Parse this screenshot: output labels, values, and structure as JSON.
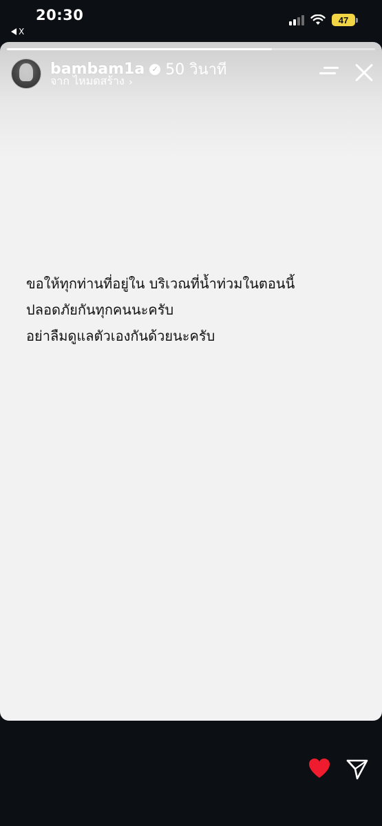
{
  "status_bar": {
    "time": "20:30",
    "back_label": "X",
    "battery": "47"
  },
  "story": {
    "progress_fraction": 0.72,
    "username": "bambam1a",
    "time_ago": "50 วินาที",
    "subtitle": "จาก ไหมดสร้าง",
    "lines": [
      "ขอให้ทุกท่านที่อยู่ใน บริเวณที่น้ำท่วมในตอนนี้",
      "ปลอดภัยกันทุกคนนะครับ",
      "อย่าลืมดูแลตัวเองกันด้วยนะครับ"
    ]
  },
  "colors": {
    "background": "#0c0f13",
    "story_bg": "#f2f2f2",
    "heart": "#ee1c2e",
    "battery": "#f2d545"
  },
  "icons": {
    "back": "back-triangle-icon",
    "signal": "cellular-signal-icon",
    "wifi": "wifi-icon",
    "battery": "battery-icon",
    "verified": "verified-badge-icon",
    "menu": "menu-icon",
    "close": "close-icon",
    "like": "heart-icon",
    "share": "send-icon"
  }
}
